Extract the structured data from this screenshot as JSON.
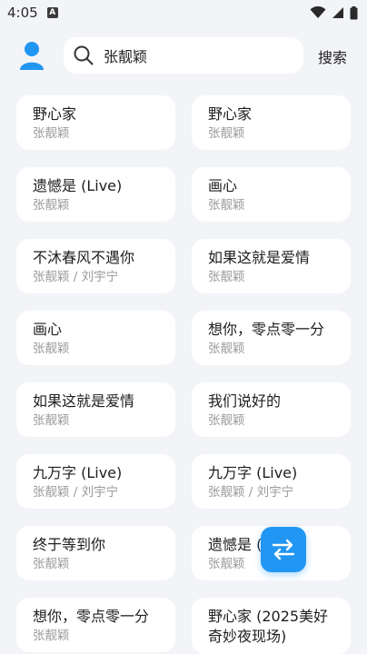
{
  "status_bar": {
    "time": "4:05",
    "notification_badge": "A"
  },
  "header": {
    "search_value": "张靓颖",
    "search_button": "搜索"
  },
  "results": [
    {
      "title": "野心家",
      "artist": "张靓颖"
    },
    {
      "title": "野心家",
      "artist": "张靓颖"
    },
    {
      "title": "遗憾是 (Live)",
      "artist": "张靓颖"
    },
    {
      "title": "画心",
      "artist": "张靓颖"
    },
    {
      "title": "不沐春风不遇你",
      "artist": "张靓颖 / 刘宇宁"
    },
    {
      "title": "如果这就是爱情",
      "artist": "张靓颖"
    },
    {
      "title": "画心",
      "artist": "张靓颖"
    },
    {
      "title": "想你，零点零一分",
      "artist": "张靓颖"
    },
    {
      "title": "如果这就是爱情",
      "artist": "张靓颖"
    },
    {
      "title": "我们说好的",
      "artist": "张靓颖"
    },
    {
      "title": "九万字 (Live)",
      "artist": "张靓颖 / 刘宇宁"
    },
    {
      "title": "九万字 (Live)",
      "artist": "张靓颖 / 刘宇宁"
    },
    {
      "title": "终于等到你",
      "artist": "张靓颖"
    },
    {
      "title": "遗憾是 (",
      "artist": "张靓颖"
    },
    {
      "title": "想你，零点零一分",
      "artist": "张靓颖"
    },
    {
      "title": "野心家 (2025美好奇妙夜现场)",
      "artist": ""
    }
  ],
  "colors": {
    "accent": "#2196f3",
    "background": "#f3f4f8"
  }
}
